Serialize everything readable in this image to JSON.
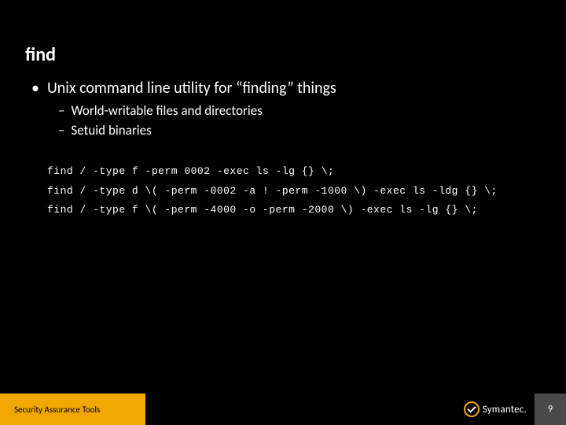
{
  "title": "find",
  "bullets": {
    "main": "Unix command line utility for “finding” things",
    "sub1": "World-writable files and directories",
    "sub2": "Setuid binaries"
  },
  "code": {
    "l1": "find / -type f -perm 0002 -exec ls -lg {} \\;",
    "l2": "find / -type d \\( -perm -0002 -a ! -perm -1000 \\) -exec ls -ldg {} \\;",
    "l3": "find / -type f \\( -perm -4000 -o -perm -2000 \\) -exec ls -lg {} \\;"
  },
  "footer": {
    "left": "Security Assurance Tools",
    "brand": "Symantec.",
    "page": "9"
  }
}
